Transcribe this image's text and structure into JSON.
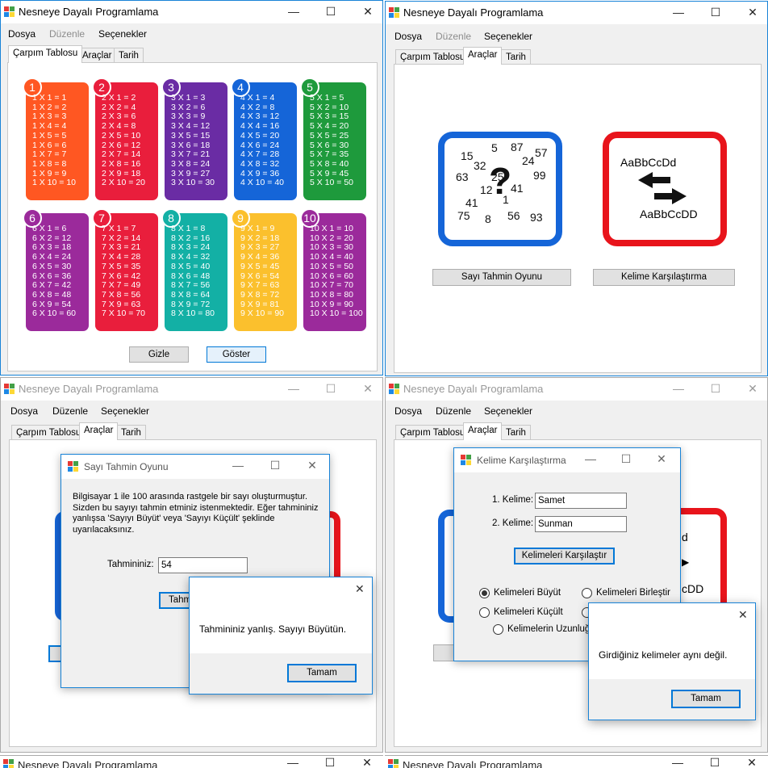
{
  "app_title": "Nesneye Dayalı Programlama",
  "window_controls": {
    "minimize": "—",
    "maximize": "☐",
    "close": "✕"
  },
  "menu": {
    "file": "Dosya",
    "edit": "Düzenle",
    "options": "Seçenekler"
  },
  "tabs": {
    "multiplication": "Çarpım Tablosu",
    "tools": "Araçlar",
    "date": "Tarih"
  },
  "colors": {
    "accent": "#0078d7",
    "card_orange": "#ff5722",
    "card_red": "#e91e3c",
    "card_purple": "#6a2ca4",
    "card_blue": "#1565d8",
    "card_green": "#1e9a3c",
    "card_magenta": "#9b2a9b",
    "card_teal": "#13b0a5",
    "card_yellow": "#fbc02d"
  },
  "multiplication_table": {
    "cards": [
      {
        "number": "1",
        "lines": [
          "1 X 1 = 1",
          "1 X 2 = 2",
          "1 X 3 = 3",
          "1 X 4 = 4",
          "1 X 5 = 5",
          "1 X 6 = 6",
          "1 X 7 = 7",
          "1 X 8 = 8",
          "1 X 9 = 9",
          "1 X 10 = 10"
        ]
      },
      {
        "number": "2",
        "lines": [
          "2 X 1 = 2",
          "2 X 2 = 4",
          "2 X 3 = 6",
          "2 X 4 = 8",
          "2 X 5 = 10",
          "2 X 6 = 12",
          "2 X 7 = 14",
          "2 X 8 = 16",
          "2 X 9 = 18",
          "2 X 10 = 20"
        ]
      },
      {
        "number": "3",
        "lines": [
          "3 X 1 = 3",
          "3 X 2 = 6",
          "3 X 3 = 9",
          "3 X 4 = 12",
          "3 X 5 = 15",
          "3 X 6 = 18",
          "3 X 7 = 21",
          "3 X 8 = 24",
          "3 X 9 = 27",
          "3 X 10 = 30"
        ]
      },
      {
        "number": "4",
        "lines": [
          "4 X 1 = 4",
          "4 X 2 = 8",
          "4 X 3 = 12",
          "4 X 4 = 16",
          "4 X 5 = 20",
          "4 X 6 = 24",
          "4 X 7 = 28",
          "4 X 8 = 32",
          "4 X 9 = 36",
          "4 X 10 = 40"
        ]
      },
      {
        "number": "5",
        "lines": [
          "5 X 1 = 5",
          "5 X 2 = 10",
          "5 X 3 = 15",
          "5 X 4 = 20",
          "5 X 5 = 25",
          "5 X 6 = 30",
          "5 X 7 = 35",
          "5 X 8 = 40",
          "5 X 9 = 45",
          "5 X 10 = 50"
        ]
      },
      {
        "number": "6",
        "lines": [
          "6 X 1 = 6",
          "6 X 2 = 12",
          "6 X 3 = 18",
          "6 X 4 = 24",
          "6 X 5 = 30",
          "6 X 6 = 36",
          "6 X 7 = 42",
          "6 X 8 = 48",
          "6 X 9 = 54",
          "6 X 10 = 60"
        ]
      },
      {
        "number": "7",
        "lines": [
          "7 X 1 = 7",
          "7 X 2 = 14",
          "7 X 3 = 21",
          "7 X 4 = 28",
          "7 X 5 = 35",
          "7 X 6 = 42",
          "7 X 7 = 49",
          "7 X 8 = 56",
          "7 X 9 = 63",
          "7 X 10 = 70"
        ]
      },
      {
        "number": "8",
        "lines": [
          "8 X 1 = 8",
          "8 X 2 = 16",
          "8 X 3 = 24",
          "8 X 4 = 32",
          "8 X 5 = 40",
          "8 X 6 = 48",
          "8 X 7 = 56",
          "8 X 8 = 64",
          "8 X 9 = 72",
          "8 X 10 = 80"
        ]
      },
      {
        "number": "9",
        "lines": [
          "9 X 1 = 9",
          "9 X 2 = 18",
          "9 X 3 = 27",
          "9 X 4 = 36",
          "9 X 5 = 45",
          "9 X 6 = 54",
          "9 X 7 = 63",
          "9 X 8 = 72",
          "9 X 9 = 81",
          "9 X 10 = 90"
        ]
      },
      {
        "number": "10",
        "lines": [
          "10 X 1 = 10",
          "10 X 2 = 20",
          "10 X 3 = 30",
          "10 X 4 = 40",
          "10 X 5 = 50",
          "10 X 6 = 60",
          "10 X 7 = 70",
          "10 X 8 = 80",
          "10 X 9 = 90",
          "10 X 10 = 100"
        ]
      }
    ],
    "hide_button": "Gizle",
    "show_button": "Göster"
  },
  "tools": {
    "number_guess_button": "Sayı Tahmin Oyunu",
    "word_compare_button": "Kelime Karşılaştırma",
    "guess_icon_numbers": [
      "15",
      "5",
      "87",
      "57",
      "32",
      "24",
      "63",
      "99",
      "12",
      "41",
      "1",
      "41",
      "75",
      "8",
      "56",
      "93",
      "25"
    ],
    "word_icon_top": "AaBbCcDd",
    "word_icon_bottom": "AaBbCcDD"
  },
  "guess_dialog": {
    "title": "Sayı Tahmin Oyunu",
    "description": "Bilgisayar 1 ile 100 arasında rastgele bir sayı oluşturmuştur. Sizden bu sayıyı tahmin etminiz istenmektedir. Eğer tahmininiz yanlışsa 'Sayıyı Büyüt' veya 'Sayıyı Küçült' şeklinde uyarılacaksınız.",
    "guess_label": "Tahmininiz:",
    "guess_value": "54",
    "guess_button_partial": "Tahm"
  },
  "guess_message": {
    "text": "Tahmininiz yanlış. Sayıyı Büyütün.",
    "ok": "Tamam"
  },
  "compare_dialog": {
    "title": "Kelime Karşılaştırma",
    "word1_label": "1. Kelime:",
    "word1_value": "Samet",
    "word2_label": "2. Kelime:",
    "word2_value": "Sunman",
    "compare_button": "Kelimeleri Karşılaştır",
    "radio_bigger": "Kelimeleri Büyüt",
    "radio_smaller": "Kelimeleri Küçült",
    "radio_merge": "Kelimeleri Birleştir",
    "radio_length": "Kelimelerin Uzunluğu"
  },
  "compare_message": {
    "text": "Girdiğiniz kelimeler aynı değil.",
    "ok": "Tamam"
  },
  "bg_icon_partial": {
    "top": "d",
    "bottom": "cDD"
  }
}
